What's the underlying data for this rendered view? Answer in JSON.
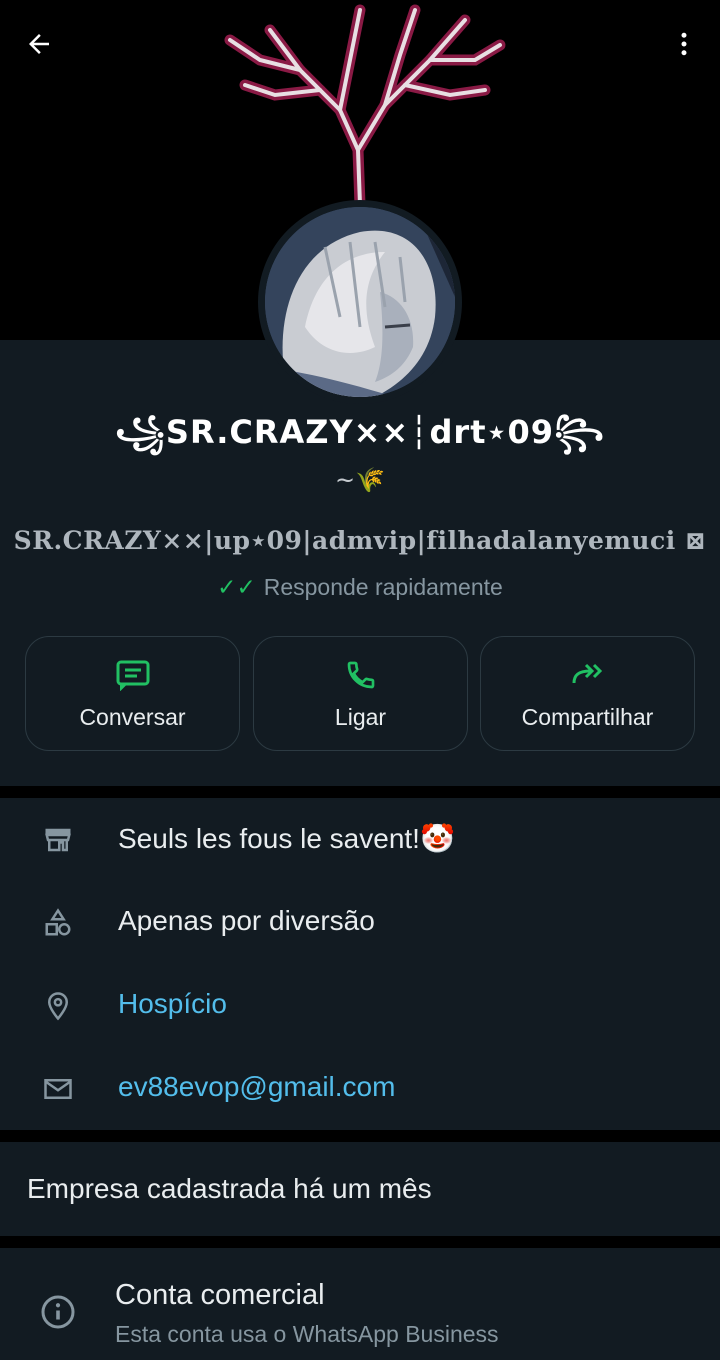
{
  "header": {
    "back_icon": "arrow-left-icon",
    "more_icon": "more-vertical-icon"
  },
  "profile": {
    "display_name": "꧁SR.CRAZY××┆drt⋆09꧂",
    "name_ornament": "~🌾",
    "tagline": "SR.CRAZY××|up⋆09|admvip|filhadalanyemuci ⊠",
    "responds_label": "Responde rapidamente"
  },
  "actions": [
    {
      "label": "Conversar",
      "icon": "message-icon"
    },
    {
      "label": "Ligar",
      "icon": "phone-icon"
    },
    {
      "label": "Compartilhar",
      "icon": "forward-icon"
    }
  ],
  "info": {
    "description": "Seuls les fous le savent!🤡",
    "category": "Apenas por diversão",
    "location": "Hospício",
    "email": "ev88evop@gmail.com"
  },
  "business_since": "Empresa cadastrada há um mês",
  "account": {
    "title": "Conta comercial",
    "subtitle": "Esta conta usa o WhatsApp Business"
  },
  "colors": {
    "background": "#121b22",
    "accent_green": "#21c063",
    "link_blue": "#53bdeb",
    "secondary_text": "#8696a0"
  }
}
